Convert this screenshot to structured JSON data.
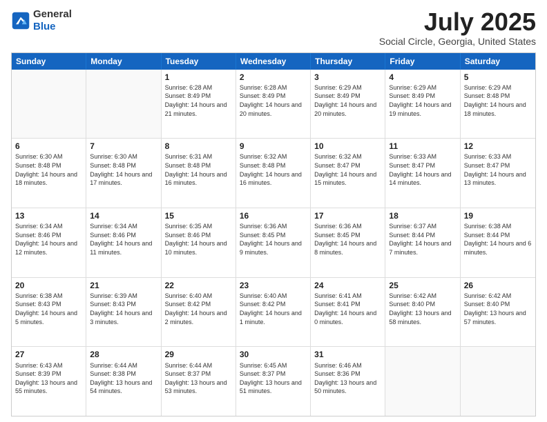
{
  "header": {
    "logo_general": "General",
    "logo_blue": "Blue",
    "month": "July 2025",
    "location": "Social Circle, Georgia, United States"
  },
  "weekdays": [
    "Sunday",
    "Monday",
    "Tuesday",
    "Wednesday",
    "Thursday",
    "Friday",
    "Saturday"
  ],
  "rows": [
    [
      {
        "day": "",
        "empty": true
      },
      {
        "day": "",
        "empty": true
      },
      {
        "day": "1",
        "sunrise": "6:28 AM",
        "sunset": "8:49 PM",
        "daylight": "14 hours and 21 minutes."
      },
      {
        "day": "2",
        "sunrise": "6:28 AM",
        "sunset": "8:49 PM",
        "daylight": "14 hours and 20 minutes."
      },
      {
        "day": "3",
        "sunrise": "6:29 AM",
        "sunset": "8:49 PM",
        "daylight": "14 hours and 20 minutes."
      },
      {
        "day": "4",
        "sunrise": "6:29 AM",
        "sunset": "8:49 PM",
        "daylight": "14 hours and 19 minutes."
      },
      {
        "day": "5",
        "sunrise": "6:29 AM",
        "sunset": "8:48 PM",
        "daylight": "14 hours and 18 minutes."
      }
    ],
    [
      {
        "day": "6",
        "sunrise": "6:30 AM",
        "sunset": "8:48 PM",
        "daylight": "14 hours and 18 minutes."
      },
      {
        "day": "7",
        "sunrise": "6:30 AM",
        "sunset": "8:48 PM",
        "daylight": "14 hours and 17 minutes."
      },
      {
        "day": "8",
        "sunrise": "6:31 AM",
        "sunset": "8:48 PM",
        "daylight": "14 hours and 16 minutes."
      },
      {
        "day": "9",
        "sunrise": "6:32 AM",
        "sunset": "8:48 PM",
        "daylight": "14 hours and 16 minutes."
      },
      {
        "day": "10",
        "sunrise": "6:32 AM",
        "sunset": "8:47 PM",
        "daylight": "14 hours and 15 minutes."
      },
      {
        "day": "11",
        "sunrise": "6:33 AM",
        "sunset": "8:47 PM",
        "daylight": "14 hours and 14 minutes."
      },
      {
        "day": "12",
        "sunrise": "6:33 AM",
        "sunset": "8:47 PM",
        "daylight": "14 hours and 13 minutes."
      }
    ],
    [
      {
        "day": "13",
        "sunrise": "6:34 AM",
        "sunset": "8:46 PM",
        "daylight": "14 hours and 12 minutes."
      },
      {
        "day": "14",
        "sunrise": "6:34 AM",
        "sunset": "8:46 PM",
        "daylight": "14 hours and 11 minutes."
      },
      {
        "day": "15",
        "sunrise": "6:35 AM",
        "sunset": "8:46 PM",
        "daylight": "14 hours and 10 minutes."
      },
      {
        "day": "16",
        "sunrise": "6:36 AM",
        "sunset": "8:45 PM",
        "daylight": "14 hours and 9 minutes."
      },
      {
        "day": "17",
        "sunrise": "6:36 AM",
        "sunset": "8:45 PM",
        "daylight": "14 hours and 8 minutes."
      },
      {
        "day": "18",
        "sunrise": "6:37 AM",
        "sunset": "8:44 PM",
        "daylight": "14 hours and 7 minutes."
      },
      {
        "day": "19",
        "sunrise": "6:38 AM",
        "sunset": "8:44 PM",
        "daylight": "14 hours and 6 minutes."
      }
    ],
    [
      {
        "day": "20",
        "sunrise": "6:38 AM",
        "sunset": "8:43 PM",
        "daylight": "14 hours and 5 minutes."
      },
      {
        "day": "21",
        "sunrise": "6:39 AM",
        "sunset": "8:43 PM",
        "daylight": "14 hours and 3 minutes."
      },
      {
        "day": "22",
        "sunrise": "6:40 AM",
        "sunset": "8:42 PM",
        "daylight": "14 hours and 2 minutes."
      },
      {
        "day": "23",
        "sunrise": "6:40 AM",
        "sunset": "8:42 PM",
        "daylight": "14 hours and 1 minute."
      },
      {
        "day": "24",
        "sunrise": "6:41 AM",
        "sunset": "8:41 PM",
        "daylight": "14 hours and 0 minutes."
      },
      {
        "day": "25",
        "sunrise": "6:42 AM",
        "sunset": "8:40 PM",
        "daylight": "13 hours and 58 minutes."
      },
      {
        "day": "26",
        "sunrise": "6:42 AM",
        "sunset": "8:40 PM",
        "daylight": "13 hours and 57 minutes."
      }
    ],
    [
      {
        "day": "27",
        "sunrise": "6:43 AM",
        "sunset": "8:39 PM",
        "daylight": "13 hours and 55 minutes."
      },
      {
        "day": "28",
        "sunrise": "6:44 AM",
        "sunset": "8:38 PM",
        "daylight": "13 hours and 54 minutes."
      },
      {
        "day": "29",
        "sunrise": "6:44 AM",
        "sunset": "8:37 PM",
        "daylight": "13 hours and 53 minutes."
      },
      {
        "day": "30",
        "sunrise": "6:45 AM",
        "sunset": "8:37 PM",
        "daylight": "13 hours and 51 minutes."
      },
      {
        "day": "31",
        "sunrise": "6:46 AM",
        "sunset": "8:36 PM",
        "daylight": "13 hours and 50 minutes."
      },
      {
        "day": "",
        "empty": true
      },
      {
        "day": "",
        "empty": true
      }
    ]
  ]
}
